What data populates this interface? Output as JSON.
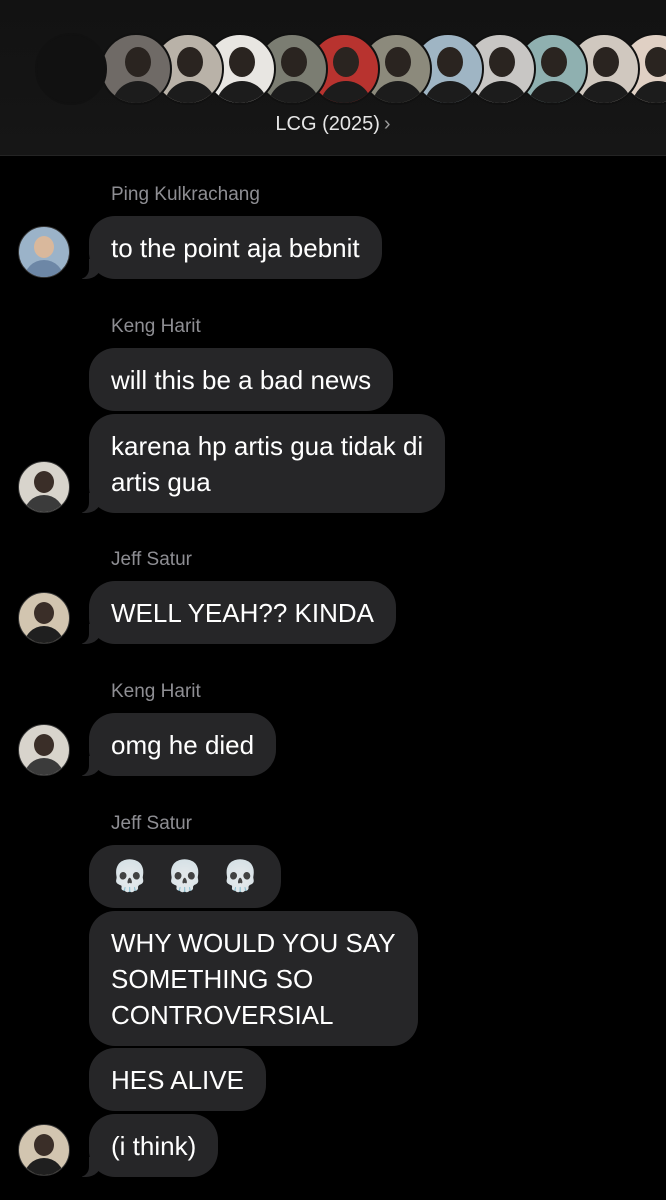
{
  "header": {
    "group_name": "LCG (2025)",
    "chevron": "›",
    "member_avatars": [
      {
        "icon": "avatar-empty-icon",
        "bg": "#111111"
      },
      {
        "icon": "avatar-photo-icon",
        "bg": "#6f6a66"
      },
      {
        "icon": "avatar-photo-icon",
        "bg": "#b9b2a8"
      },
      {
        "icon": "avatar-photo-icon",
        "bg": "#e8e6e2"
      },
      {
        "icon": "avatar-photo-icon",
        "bg": "#7b7d72"
      },
      {
        "icon": "avatar-photo-icon",
        "bg": "#b8332f"
      },
      {
        "icon": "avatar-photo-icon",
        "bg": "#8c8a7c"
      },
      {
        "icon": "avatar-photo-icon",
        "bg": "#9fb5c4"
      },
      {
        "icon": "avatar-photo-icon",
        "bg": "#c8c6c4"
      },
      {
        "icon": "avatar-photo-icon",
        "bg": "#8fb0b0"
      },
      {
        "icon": "avatar-photo-icon",
        "bg": "#d0c8bf"
      },
      {
        "icon": "avatar-photo-icon",
        "bg": "#e0d0c4"
      }
    ]
  },
  "messages": {
    "s1": "Ping Kulkrachang",
    "m1": "to the point aja bebnit",
    "s2": "Keng Harit",
    "m2": "will this be a bad news",
    "m3_line1": "karena hp artis gua tidak di",
    "m3_line2": "artis gua",
    "s3": "Jeff Satur",
    "m4": "WELL YEAH?? KINDA",
    "s4": "Keng Harit",
    "m5": "omg he died",
    "s5": "Jeff Satur",
    "m6_emoji": [
      "💀",
      "💀",
      "💀"
    ],
    "m7_line1": "WHY WOULD YOU SAY",
    "m7_line2": "SOMETHING SO",
    "m7_line3": "CONTROVERSIAL",
    "m8": "HES ALIVE",
    "m9": "(i think)"
  },
  "colors": {
    "bubble": "#262628",
    "sender": "#8e8e93",
    "background": "#000000"
  }
}
